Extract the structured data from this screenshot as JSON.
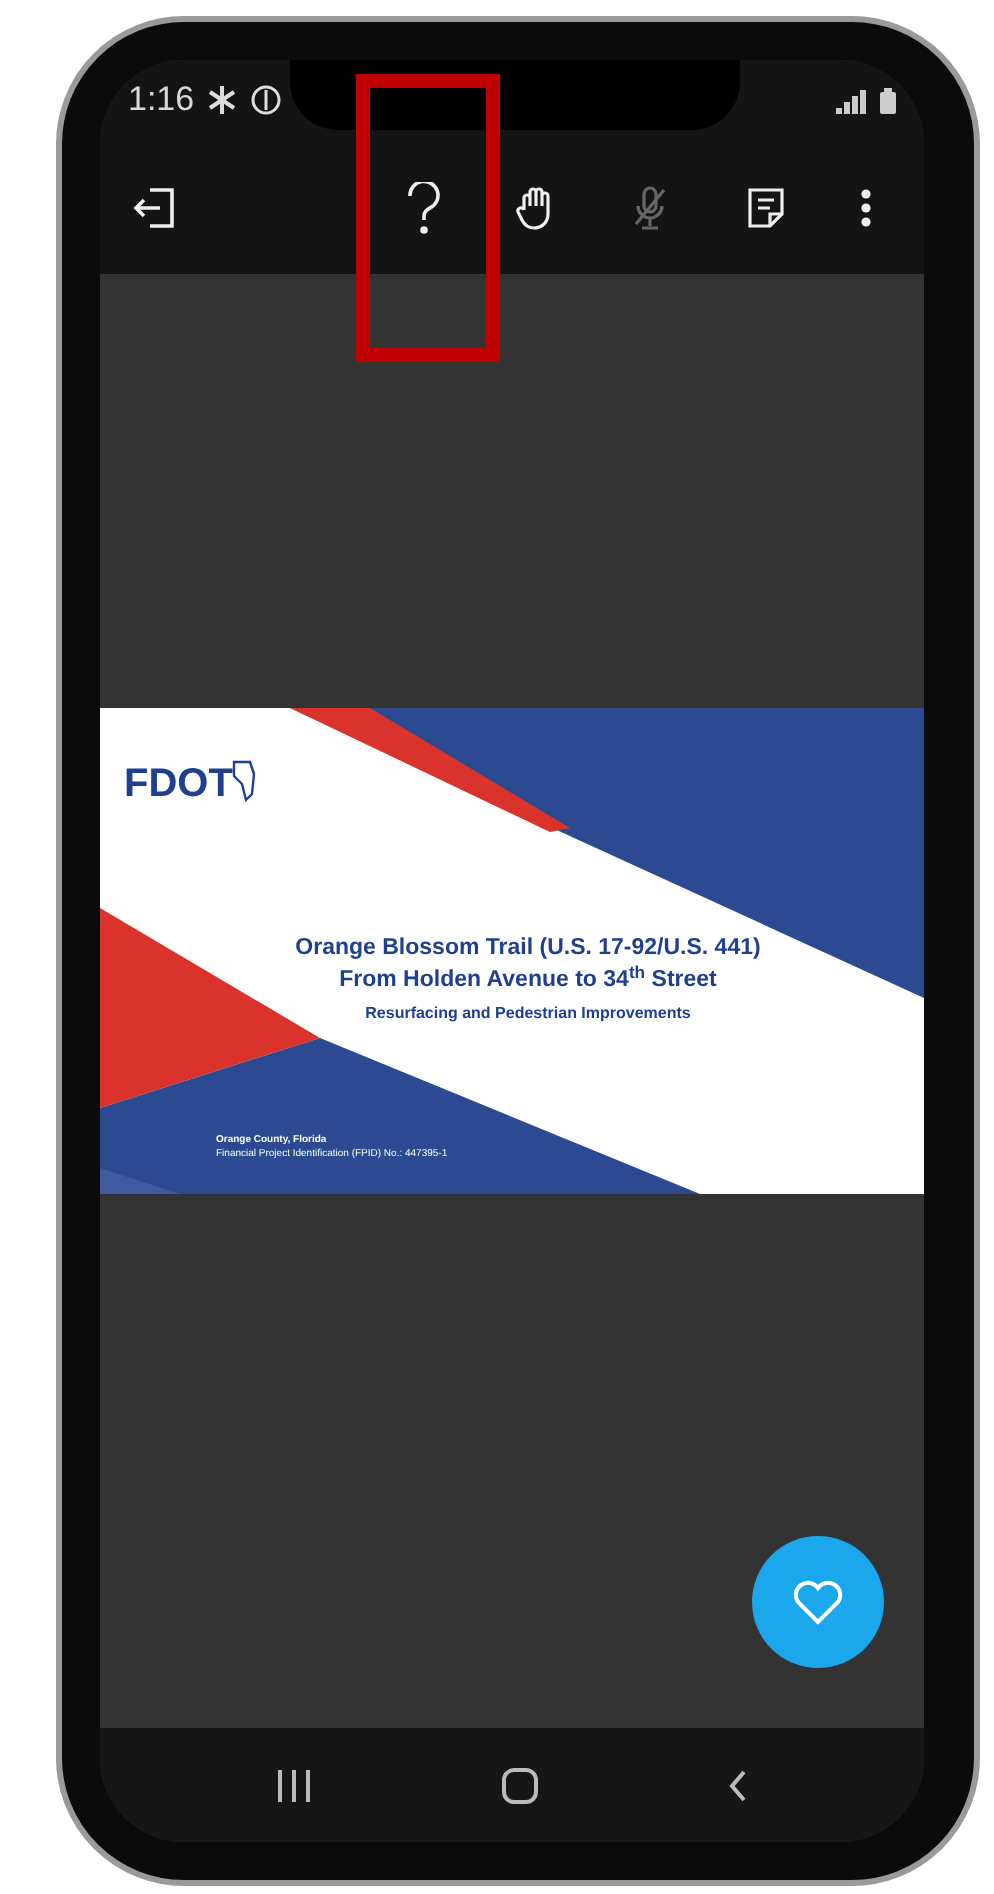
{
  "status_bar": {
    "time": "1:16"
  },
  "slide": {
    "logo": "FDOT",
    "title_lines": [
      "Orange Blossom Trail (U.S. 17-92/U.S. 441)",
      "From Holden Avenue to 34$^{th}$ Street"
    ],
    "subtitle": "Resurfacing and Pedestrian Improvements",
    "county": "Orange County, Florida",
    "project_id": "Financial Project Identification (FPID) No.: 447395-1"
  }
}
